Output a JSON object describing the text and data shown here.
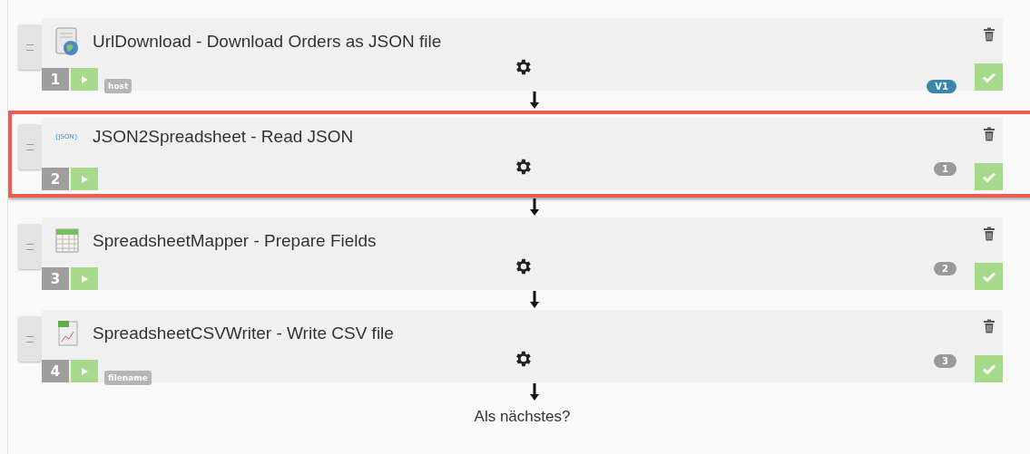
{
  "steps": [
    {
      "number": "1",
      "title": "UrlDownload - Download Orders as JSON file",
      "tag": "host",
      "badge": {
        "kind": "version",
        "text": "V1"
      },
      "highlighted": false
    },
    {
      "number": "2",
      "icon_label": "{JSON}",
      "title": "JSON2Spreadsheet - Read JSON",
      "badge": {
        "kind": "count",
        "text": "1"
      },
      "highlighted": true
    },
    {
      "number": "3",
      "title": "SpreadsheetMapper - Prepare Fields",
      "badge": {
        "kind": "count",
        "text": "2"
      },
      "highlighted": false
    },
    {
      "number": "4",
      "title": "SpreadsheetCSVWriter - Write CSV file",
      "tag": "filename",
      "badge": {
        "kind": "count",
        "text": "3"
      },
      "highlighted": false
    }
  ],
  "next_prompt": "Als nächstes?"
}
